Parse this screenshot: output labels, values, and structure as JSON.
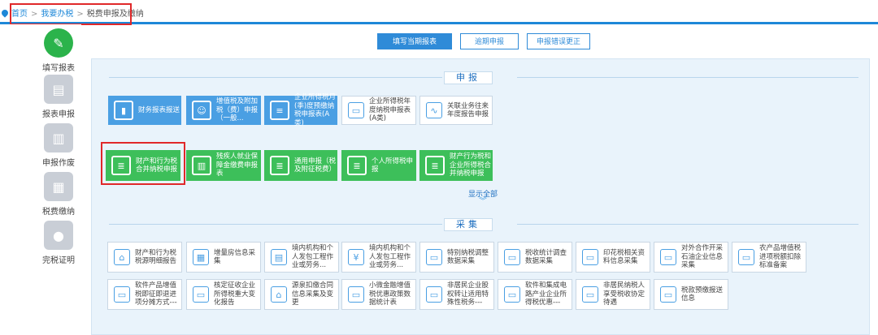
{
  "breadcrumb": {
    "home": "首页",
    "level1": "我要办税",
    "level2": "税费申报及缴纳",
    "separator": ">"
  },
  "sidebar": {
    "items": [
      {
        "label": "填写报表",
        "icon": "pencil-icon"
      },
      {
        "label": "报表申报",
        "icon": "report-icon"
      },
      {
        "label": "申报作废",
        "icon": "void-icon"
      },
      {
        "label": "税费缴纳",
        "icon": "payment-icon"
      },
      {
        "label": "完税证明",
        "icon": "certificate-icon"
      }
    ]
  },
  "tabs": [
    {
      "label": "填写当期报表",
      "active": true
    },
    {
      "label": "逾期申报",
      "active": false
    },
    {
      "label": "申报错误更正",
      "active": false
    }
  ],
  "sections": {
    "declare_title": "申报",
    "collect_title": "采集",
    "show_all": "显示全部"
  },
  "declare_row1": [
    {
      "label": "财务报表报送",
      "icon": "chart-icon"
    },
    {
      "label": "增值税及附加税（费）申报（一般...",
      "icon": "person-icon"
    },
    {
      "label": "企业所得税月(季)度预缴纳税申报表(A类)",
      "icon": "list-icon"
    },
    {
      "label": "企业所得税年度纳税申报表(A类)",
      "icon": "monitor-icon"
    },
    {
      "label": "关联业务往来年度报告申报",
      "icon": "trend-icon"
    }
  ],
  "declare_row2": [
    {
      "label": "财产和行为税合并纳税申报",
      "icon": "doc-icon"
    },
    {
      "label": "残疾人就业保障金缴费申报表",
      "icon": "books-icon"
    },
    {
      "label": "通用申报（税及附征税费）",
      "icon": "doc-icon"
    },
    {
      "label": "个人所得税申报",
      "icon": "doc-icon"
    },
    {
      "label": "财产行为税和企业所得税合并纳税申报",
      "icon": "doc-icon"
    }
  ],
  "collect_row1": [
    "财产和行为税税源明细报告",
    "增量房信息采集",
    "境内机构和个人发包工程作业或劳务...",
    "境内机构和个人发包工程作业或劳务...",
    "特别纳税调整数据采集",
    "税收统计调查数据采集",
    "印花税相关资料信息采集",
    "对外合作开采石油企业信息采集",
    "农产品增值税进项税额扣除标准备案"
  ],
  "collect_row2": [
    "软件产品增值税即征即退进项分摊方式---",
    "核定征收企业所得税重大变化报告",
    "源泉扣缴合同信息采集及变更",
    "小微金融增值税优惠政策数据统计表",
    "非居民企业股权转让适用特殊性税务---",
    "软件和集成电路产业企业所得税优惠---",
    "非居民纳税人享受税收协定待遇",
    "税款预缴报送信息"
  ]
}
